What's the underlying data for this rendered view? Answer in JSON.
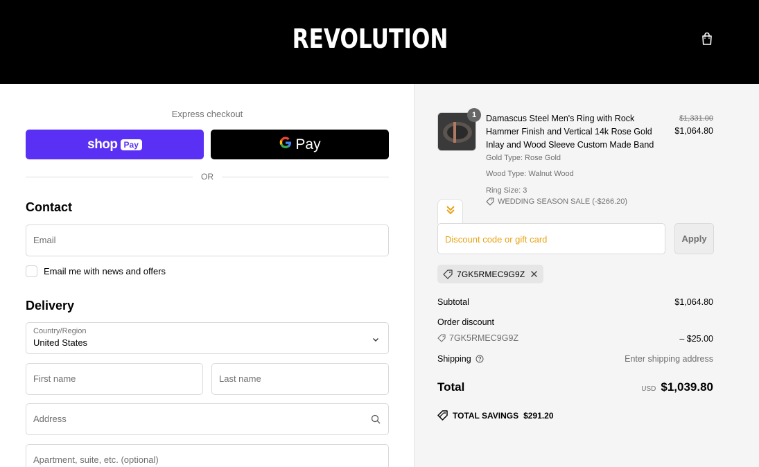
{
  "header": {
    "logo": "REVOLUTION",
    "cart_icon": "shopping-bag-icon"
  },
  "express": {
    "label": "Express checkout",
    "shoppay_text": "shop",
    "shoppay_badge": "Pay",
    "gpay_text": "Pay",
    "or_text": "OR"
  },
  "contact": {
    "title": "Contact",
    "email_placeholder": "Email",
    "newsletter_label": "Email me with news and offers"
  },
  "delivery": {
    "title": "Delivery",
    "country_label": "Country/Region",
    "country_value": "United States",
    "first_name_placeholder": "First name",
    "last_name_placeholder": "Last name",
    "address_placeholder": "Address",
    "apartment_placeholder": "Apartment, suite, etc. (optional)"
  },
  "summary": {
    "item": {
      "quantity": "1",
      "title": "Damascus Steel Men's Ring with Rock Hammer Finish and Vertical 14k Rose Gold Inlay and Wood Sleeve Custom Made Band",
      "gold_type": "Gold Type: Rose Gold",
      "wood_type": "Wood Type: Walnut Wood",
      "ring_size": "Ring Size: 3",
      "item_discount": "WEDDING SEASON SALE (-$266.20)",
      "price_original": "$1,331.00",
      "price_final": "$1,064.80"
    },
    "discount_placeholder": "Discount code or gift card",
    "apply_label": "Apply",
    "applied_code": "7GK5RMEC9G9Z",
    "subtotal_label": "Subtotal",
    "subtotal_value": "$1,064.80",
    "order_discount_label": "Order discount",
    "order_discount_code": "7GK5RMEC9G9Z",
    "order_discount_value": "– $25.00",
    "shipping_label": "Shipping",
    "shipping_value": "Enter shipping address",
    "total_label": "Total",
    "total_currency": "USD",
    "total_value": "$1,039.80",
    "savings_label": "TOTAL SAVINGS",
    "savings_value": "$291.20"
  },
  "colors": {
    "shoppay": "#5a31f4",
    "discount_placeholder": "#e8a317",
    "summary_bg": "#f5f5f5"
  }
}
